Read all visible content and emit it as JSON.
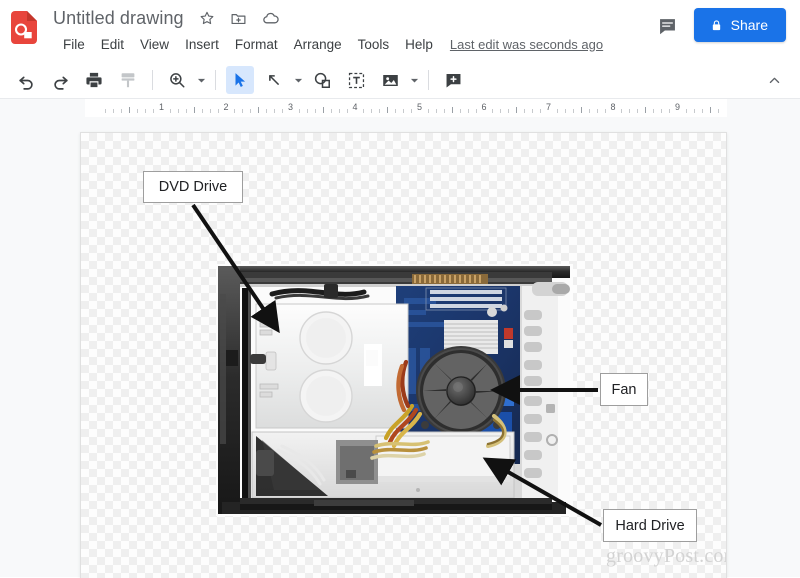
{
  "header": {
    "logo_icon": "google-drawings-logo",
    "doc_title": "Untitled drawing",
    "title_icons": [
      {
        "name": "star-icon",
        "glyph": "star"
      },
      {
        "name": "move-to-folder-icon",
        "glyph": "folder"
      },
      {
        "name": "cloud-saved-icon",
        "glyph": "cloud"
      }
    ],
    "menu_items": [
      {
        "label": "File"
      },
      {
        "label": "Edit"
      },
      {
        "label": "View"
      },
      {
        "label": "Insert"
      },
      {
        "label": "Format"
      },
      {
        "label": "Arrange"
      },
      {
        "label": "Tools"
      },
      {
        "label": "Help"
      }
    ],
    "last_edit": "Last edit was seconds ago",
    "comment_icon": "comment-icon",
    "share": {
      "label": "Share",
      "icon": "lock-icon",
      "color": "#1a73e8"
    }
  },
  "toolbar": {
    "items": [
      {
        "name": "undo-button",
        "icon": "undo-icon",
        "state": "enabled"
      },
      {
        "name": "redo-button",
        "icon": "redo-icon",
        "state": "enabled"
      },
      {
        "name": "print-button",
        "icon": "print-icon",
        "state": "enabled"
      },
      {
        "name": "paint-format-button",
        "icon": "paint-format-icon",
        "state": "disabled"
      },
      {
        "name": "zoom-button",
        "icon": "zoom-in-icon",
        "state": "enabled",
        "caret": true
      },
      {
        "name": "select-tool-button",
        "icon": "cursor-arrow-icon",
        "state": "active"
      },
      {
        "name": "line-tool-button",
        "icon": "line-icon",
        "state": "enabled",
        "caret": true
      },
      {
        "name": "shape-tool-button",
        "icon": "shape-icon",
        "state": "enabled"
      },
      {
        "name": "text-box-button",
        "icon": "text-box-icon",
        "state": "enabled"
      },
      {
        "name": "image-button",
        "icon": "image-icon",
        "state": "enabled",
        "caret": true
      },
      {
        "name": "add-comment-button",
        "icon": "add-comment-icon",
        "state": "enabled"
      }
    ],
    "collapse_icon": "chevron-up-icon"
  },
  "ruler": {
    "numbers": [
      1,
      2,
      3,
      4,
      5,
      6,
      7,
      8,
      9
    ],
    "unit": "inch"
  },
  "canvas": {
    "background": "transparent-checkerboard",
    "image": {
      "name": "desktop-pc-interior-photo",
      "alt": "Open desktop computer case interior showing DVD drive, motherboard, CPU fan and hard drive"
    },
    "callouts": [
      {
        "id": "dvd",
        "label": "DVD Drive"
      },
      {
        "id": "fan",
        "label": "Fan"
      },
      {
        "id": "hdd",
        "label": "Hard Drive"
      }
    ],
    "watermark": "groovyPost.com"
  }
}
